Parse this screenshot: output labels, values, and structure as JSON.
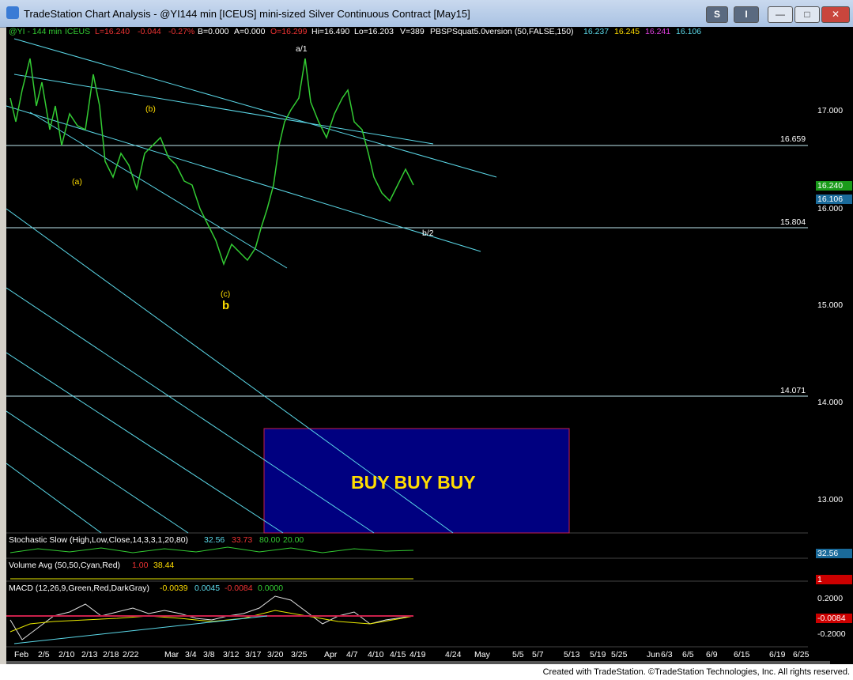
{
  "window": {
    "title": "TradeStation Chart Analysis - @YI144 min [ICEUS] mini-sized Silver Continuous Contract [May15]",
    "buttons": {
      "s": "S",
      "i": "I",
      "minimize": "—",
      "maximize": "□",
      "close": "✕"
    }
  },
  "colors": {
    "bg": "#000000",
    "price": "#33cc33",
    "channel": "#5bd8e8",
    "buybox": "#000080",
    "buybox_border": "#c8204a",
    "text_yellow": "#ffdd00"
  },
  "header": {
    "symbol": "@YI - 144 min",
    "exchange": "ICEUS",
    "last": "L=16.240",
    "change": "-0.044",
    "pct": "-0.27%",
    "bid": "B=0.000",
    "ask": "A=0.000",
    "open": "O=16.299",
    "high": "Hi=16.490",
    "low": "Lo=16.203",
    "volume": "V=389",
    "study": "PBSPSquat5.0version (50,FALSE,150)",
    "v1": "16.237",
    "v2": "16.245",
    "v3": "16.241",
    "v4": "16.106"
  },
  "stochastic": {
    "label": "Stochastic Slow (High,Low,Close,14,3,3,1,20,80)",
    "v1": "32.56",
    "v2": "33.73",
    "v3": "80.00",
    "v4": "20.00",
    "box": "32.56"
  },
  "volume": {
    "label": "Volume Avg (50,50,Cyan,Red)",
    "v1": "1.00",
    "v2": "38.44",
    "box": "1"
  },
  "macd": {
    "label": "MACD (12,26,9,Green,Red,DarkGray)",
    "v1": "-0.0039",
    "v2": "0.0045",
    "v3": "-0.0084",
    "v4": "0.0000",
    "t1": "0.2000",
    "t2": "-0.2000",
    "box": "-0.0084"
  },
  "price_axis": {
    "ticks": [
      "17.000",
      "16.000",
      "15.000",
      "14.000",
      "13.000"
    ],
    "level_16659": "16.659",
    "level_15804": "15.804",
    "level_14071": "14.071",
    "last_box": "16.240",
    "last_box2": "16.106"
  },
  "labels": {
    "a1": "a/1",
    "b": "(b)",
    "a": "(a)",
    "c": "(c)",
    "bbig": "b",
    "b2": "b/2",
    "buy": "BUY BUY BUY"
  },
  "time_axis": [
    "Feb",
    "2/5",
    "2/10",
    "2/13",
    "2/18",
    "2/22",
    "Mar",
    "3/4",
    "3/8",
    "3/12",
    "3/17",
    "3/20",
    "3/25",
    "Apr",
    "4/7",
    "4/10",
    "4/15",
    "4/19",
    "4/24",
    "May",
    "5/5",
    "5/7",
    "5/13",
    "5/19",
    "5/25",
    "Jun",
    "6/3",
    "6/5",
    "6/9",
    "6/15",
    "6/19",
    "6/25"
  ],
  "footer": "Created with TradeStation. ©TradeStation Technologies, Inc. All rights reserved."
}
